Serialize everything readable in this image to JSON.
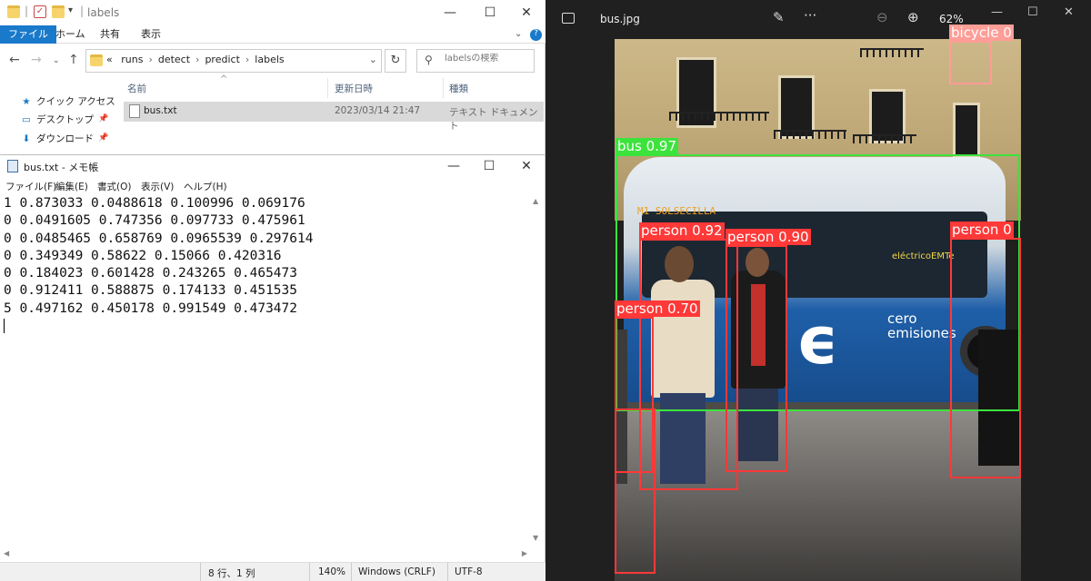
{
  "explorer": {
    "title": "labels",
    "ribbon_tabs": [
      "ファイル",
      "ホーム",
      "共有",
      "表示"
    ],
    "breadcrumbs": [
      "runs",
      "detect",
      "predict",
      "labels"
    ],
    "breadcrumb_prefix": "«",
    "search_placeholder": "labelsの検索",
    "nav_items": [
      {
        "label": "クイック アクセス",
        "icon": "star-icon"
      },
      {
        "label": "デスクトップ",
        "icon": "desktop-icon"
      },
      {
        "label": "ダウンロード",
        "icon": "download-icon"
      }
    ],
    "columns": [
      "名前",
      "更新日時",
      "種類"
    ],
    "files": [
      {
        "name": "bus.txt",
        "modified": "2023/03/14 21:47",
        "type": "テキスト ドキュメント"
      }
    ]
  },
  "notepad": {
    "title": "bus.txt - メモ帳",
    "menu": [
      "ファイル(F)",
      "編集(E)",
      "書式(O)",
      "表示(V)",
      "ヘルプ(H)"
    ],
    "lines": [
      "1 0.873033 0.0488618 0.100996 0.069176",
      "0 0.0491605 0.747356 0.097733 0.475961",
      "0 0.0485465 0.658769 0.0965539 0.297614",
      "0 0.349349 0.58622 0.15066 0.420316",
      "0 0.184023 0.601428 0.243265 0.465473",
      "0 0.912411 0.588875 0.174133 0.451535",
      "5 0.497162 0.450178 0.991549 0.473472"
    ],
    "status": {
      "position": "8 行、1 列",
      "zoom": "140%",
      "line_ending": "Windows (CRLF)",
      "encoding": "UTF-8"
    }
  },
  "viewer": {
    "title": "bus.jpg",
    "zoom": "62%",
    "photo_text": {
      "route": "M1 SOLSECILLA",
      "brand": "eléctricoEMTe",
      "slogan": "cero\nemisiones"
    },
    "detections": [
      {
        "label": "bicycle 0",
        "color": "pink"
      },
      {
        "label": "bus 0.97",
        "color": "green"
      },
      {
        "label": "person 0.92",
        "color": "red"
      },
      {
        "label": "person 0.90",
        "color": "red"
      },
      {
        "label": "person 0",
        "color": "red"
      },
      {
        "label": "person 0.70",
        "color": "red"
      },
      {
        "label": "",
        "color": "red"
      }
    ]
  }
}
